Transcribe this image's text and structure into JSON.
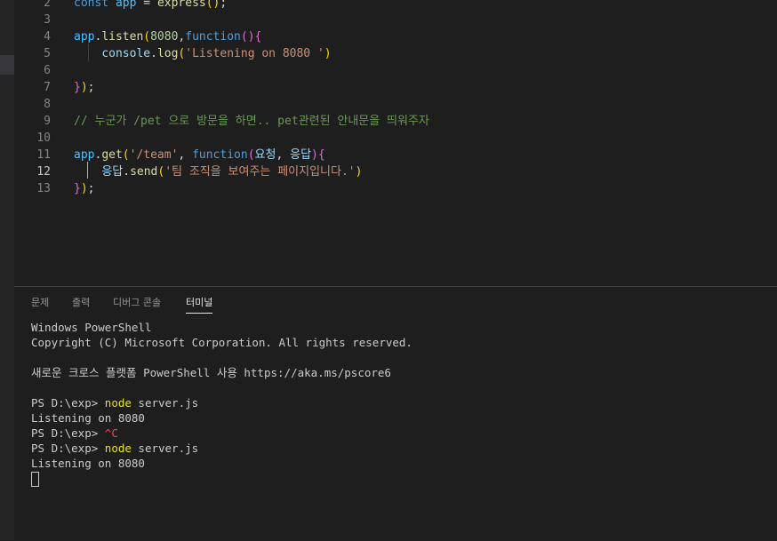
{
  "editor": {
    "lines": [
      {
        "num": "2",
        "tokens": [
          [
            "kw",
            "const"
          ],
          [
            "pl",
            " "
          ],
          [
            "var",
            "app"
          ],
          [
            "pl",
            " = "
          ],
          [
            "fn",
            "express"
          ],
          [
            "p1",
            "()"
          ],
          [
            "pl",
            ";"
          ]
        ]
      },
      {
        "num": "3",
        "tokens": []
      },
      {
        "num": "4",
        "tokens": [
          [
            "var",
            "app"
          ],
          [
            "pl",
            "."
          ],
          [
            "fn",
            "listen"
          ],
          [
            "p1",
            "("
          ],
          [
            "num",
            "8080"
          ],
          [
            "pl",
            ","
          ],
          [
            "kw",
            "function"
          ],
          [
            "p2",
            "()"
          ],
          [
            "p2",
            "{"
          ]
        ]
      },
      {
        "num": "5",
        "tokens": [
          [
            "pl",
            "    "
          ],
          [
            "id",
            "console"
          ],
          [
            "pl",
            "."
          ],
          [
            "fn",
            "log"
          ],
          [
            "p1",
            "("
          ],
          [
            "str",
            "'Listening on 8080 '"
          ],
          [
            "p1",
            ")"
          ]
        ]
      },
      {
        "num": "6",
        "tokens": []
      },
      {
        "num": "7",
        "tokens": [
          [
            "p2",
            "}"
          ],
          [
            "p1",
            ")"
          ],
          [
            "pl",
            ";"
          ]
        ]
      },
      {
        "num": "8",
        "tokens": []
      },
      {
        "num": "9",
        "tokens": [
          [
            "cmt",
            "// 누군가 /pet 으로 방문을 하면.. pet관련된 안내문을 띄워주자"
          ]
        ]
      },
      {
        "num": "10",
        "tokens": []
      },
      {
        "num": "11",
        "tokens": [
          [
            "var",
            "app"
          ],
          [
            "pl",
            "."
          ],
          [
            "fn",
            "get"
          ],
          [
            "p1",
            "("
          ],
          [
            "str",
            "'/team'"
          ],
          [
            "pl",
            ", "
          ],
          [
            "kw",
            "function"
          ],
          [
            "p2",
            "("
          ],
          [
            "id",
            "요청"
          ],
          [
            "pl",
            ", "
          ],
          [
            "id",
            "응답"
          ],
          [
            "p2",
            ")"
          ],
          [
            "p2",
            "{"
          ]
        ]
      },
      {
        "num": "12",
        "tokens": [
          [
            "pl",
            "    "
          ],
          [
            "id",
            "응답"
          ],
          [
            "pl",
            "."
          ],
          [
            "fn",
            "send"
          ],
          [
            "p1",
            "("
          ],
          [
            "str",
            "'팀 조직을 보여주는 페이지입니다.'"
          ],
          [
            "p1",
            ")"
          ]
        ]
      },
      {
        "num": "13",
        "tokens": [
          [
            "p2",
            "}"
          ],
          [
            "p1",
            ")"
          ],
          [
            "pl",
            ";"
          ]
        ]
      }
    ]
  },
  "panel": {
    "tabs": [
      {
        "label": "문제",
        "active": false
      },
      {
        "label": "출력",
        "active": false
      },
      {
        "label": "디버그 콘솔",
        "active": false
      },
      {
        "label": "터미널",
        "active": true
      }
    ],
    "terminal": [
      {
        "segs": [
          [
            "",
            "Windows PowerShell"
          ]
        ]
      },
      {
        "segs": [
          [
            "",
            "Copyright (C) Microsoft Corporation. All rights reserved."
          ]
        ]
      },
      {
        "segs": []
      },
      {
        "segs": [
          [
            "",
            "새로운 크로스 플랫폼 PowerShell 사용 https://aka.ms/pscore6"
          ]
        ]
      },
      {
        "segs": []
      },
      {
        "segs": [
          [
            "",
            "PS D:\\exp> "
          ],
          [
            "y",
            "node"
          ],
          [
            "",
            " server.js"
          ]
        ]
      },
      {
        "segs": [
          [
            "",
            "Listening on 8080"
          ]
        ]
      },
      {
        "segs": [
          [
            "",
            "PS D:\\exp> "
          ],
          [
            "r",
            "^C"
          ]
        ]
      },
      {
        "segs": [
          [
            "",
            "PS D:\\exp> "
          ],
          [
            "y",
            "node"
          ],
          [
            "",
            " server.js"
          ]
        ]
      },
      {
        "segs": [
          [
            "",
            "Listening on 8080"
          ]
        ]
      }
    ]
  }
}
